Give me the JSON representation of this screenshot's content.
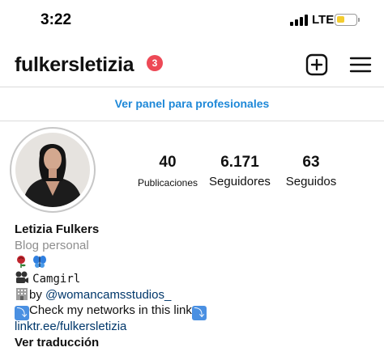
{
  "status_bar": {
    "time": "3:22",
    "network": "LTE",
    "battery_color": "#f3cc2f",
    "battery_level": 0.45
  },
  "header": {
    "username": "fulkersletizia",
    "notification_count": "3",
    "icons": [
      "new-post-icon",
      "menu-icon"
    ]
  },
  "pro_panel": {
    "label": "Ver panel para profesionales",
    "color": "#1e88d8"
  },
  "stats": [
    {
      "value": "40",
      "label": "Publicaciones"
    },
    {
      "value": "6.171",
      "label": "Seguidores"
    },
    {
      "value": "63",
      "label": "Seguidos"
    }
  ],
  "bio": {
    "name": "Letizia Fulkers",
    "category": "Blog personal",
    "line_camgirl": "Camgirl",
    "line_by_prefix": "by ",
    "mention": "@womancamsstudios_",
    "line_networks": "Check my networks in this link",
    "link": "linktr.ee/fulkersletizia",
    "translate": "Ver traducción",
    "icons": [
      "rose-icon",
      "butterfly-icon",
      "camera-icon",
      "building-icon",
      "down-arrow-icon"
    ]
  }
}
